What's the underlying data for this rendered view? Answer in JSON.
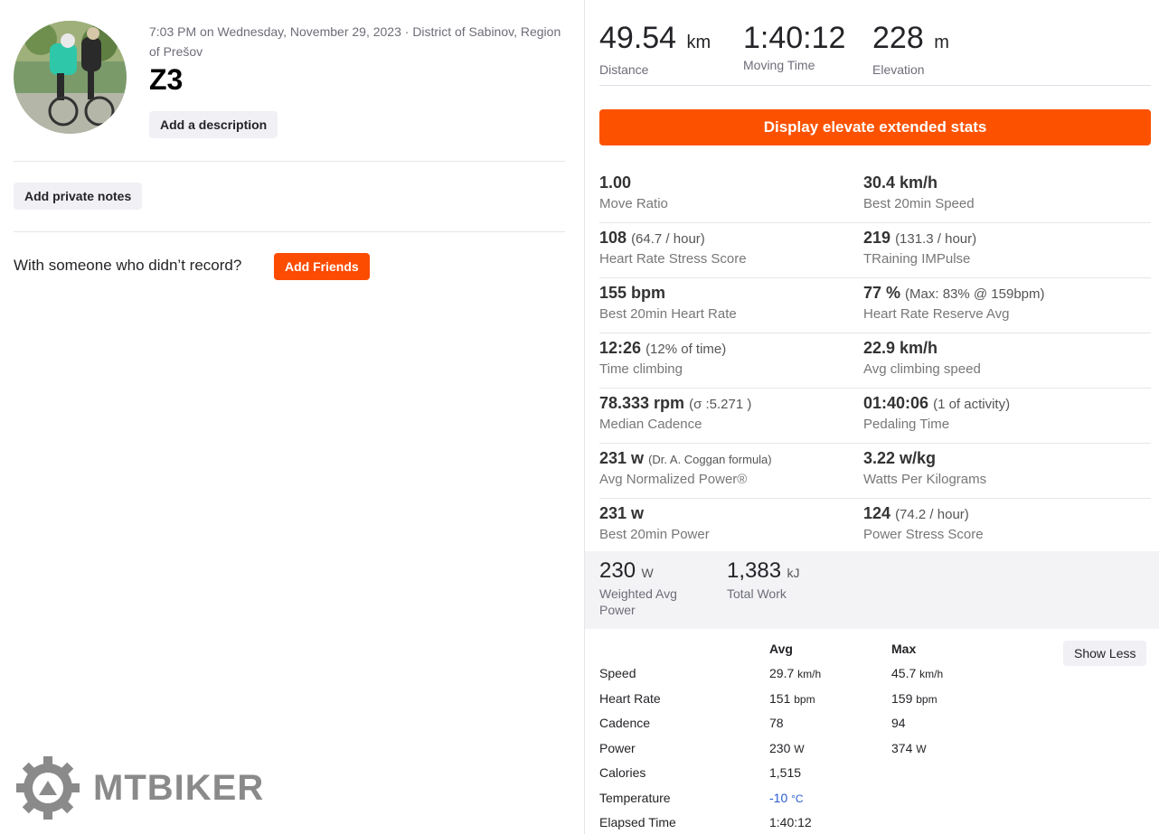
{
  "activity": {
    "meta": "7:03 PM on Wednesday, November 29, 2023 · District of Sabinov, Region of Prešov",
    "title": "Z3",
    "add_description": "Add a description",
    "add_private_notes": "Add private notes",
    "with_someone": "With someone who didn’t record?",
    "add_friends": "Add Friends"
  },
  "watermark": {
    "text": "MTBIKER"
  },
  "top_stats": [
    {
      "value": "49.54",
      "unit": "km",
      "label": "Distance"
    },
    {
      "value": "1:40:12",
      "unit": "",
      "label": "Moving Time"
    },
    {
      "value": "228",
      "unit": "m",
      "label": "Elevation"
    }
  ],
  "elevate_button": "Display elevate extended stats",
  "extended": {
    "move_ratio": {
      "value": "1.00",
      "extra": "",
      "label": "Move Ratio"
    },
    "best20_speed": {
      "value": "30.4 km/h",
      "extra": "",
      "label": "Best 20min Speed"
    },
    "hrss": {
      "value": "108",
      "extra": "(64.7 / hour)",
      "label": "Heart Rate Stress Score"
    },
    "trimp": {
      "value": "219",
      "extra": "(131.3 / hour)",
      "label": "TRaining IMPulse"
    },
    "best20_hr": {
      "value": "155 bpm",
      "extra": "",
      "label": "Best 20min Heart Rate"
    },
    "hrr": {
      "value": "77 %",
      "extra": "(Max: 83% @ 159bpm)",
      "label": "Heart Rate Reserve Avg"
    },
    "time_climbing": {
      "value": "12:26",
      "extra": "(12% of time)",
      "label": "Time climbing"
    },
    "avg_climb_speed": {
      "value": "22.9 km/h",
      "extra": "",
      "label": "Avg climbing speed"
    },
    "median_cadence": {
      "value": "78.333 rpm",
      "extra": "(σ :5.271 )",
      "label": "Median Cadence"
    },
    "pedaling_time": {
      "value": "01:40:06",
      "extra": "(1 of activity)",
      "label": "Pedaling Time"
    },
    "norm_power": {
      "value": "231 w",
      "extra": "(Dr. A. Coggan formula)",
      "label": "Avg Normalized Power®"
    },
    "wpkg": {
      "value": "3.22 w/kg",
      "extra": "",
      "label": "Watts Per Kilograms"
    },
    "best20_power": {
      "value": "231 w",
      "extra": "",
      "label": "Best 20min Power"
    },
    "pss": {
      "value": "124",
      "extra": "(74.2 / hour)",
      "label": "Power Stress Score"
    }
  },
  "power_box": [
    {
      "value": "230",
      "unit": "W",
      "label": "Weighted Avg Power"
    },
    {
      "value": "1,383",
      "unit": "kJ",
      "label": "Total Work"
    }
  ],
  "table": {
    "header_avg": "Avg",
    "header_max": "Max",
    "show_less": "Show Less",
    "rows": [
      {
        "label": "Speed",
        "avg": "29.7",
        "avg_unit": "km/h",
        "max": "45.7",
        "max_unit": "km/h"
      },
      {
        "label": "Heart Rate",
        "avg": "151",
        "avg_unit": "bpm",
        "max": "159",
        "max_unit": "bpm"
      },
      {
        "label": "Cadence",
        "avg": "78",
        "avg_unit": "",
        "max": "94",
        "max_unit": ""
      },
      {
        "label": "Power",
        "avg": "230",
        "avg_unit": "W",
        "max": "374",
        "max_unit": "W"
      },
      {
        "label": "Calories",
        "avg": "1,515",
        "avg_unit": "",
        "max": "",
        "max_unit": ""
      },
      {
        "label": "Temperature",
        "avg": "-10",
        "avg_unit": "°C",
        "max": "",
        "max_unit": ""
      },
      {
        "label": "Elapsed Time",
        "avg": "1:40:12",
        "avg_unit": "",
        "max": "",
        "max_unit": ""
      }
    ]
  },
  "colors": {
    "accent": "#fc4c02",
    "temperature": "#2a5bd7"
  }
}
